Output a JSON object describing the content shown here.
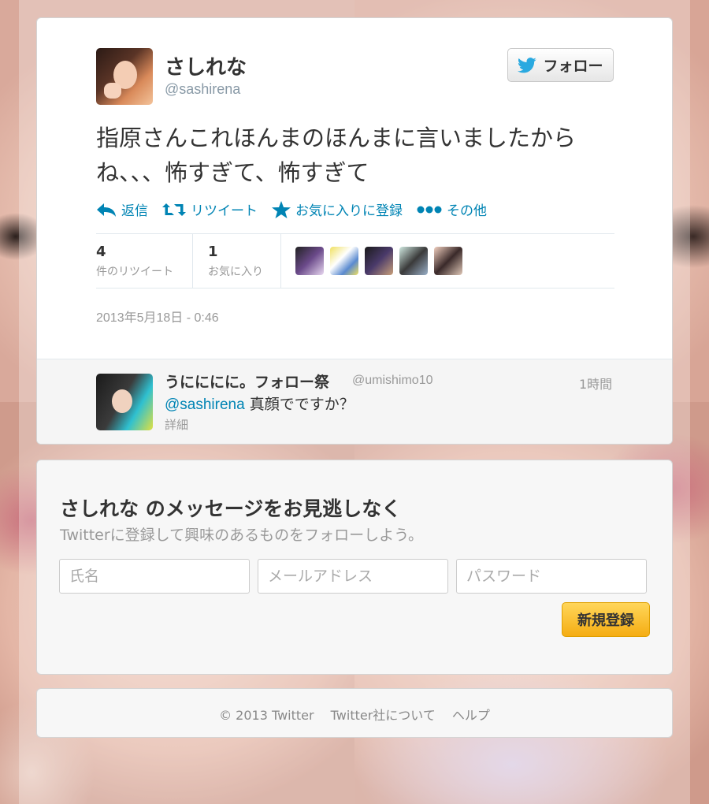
{
  "tweet": {
    "author_name": "さしれな",
    "author_handle": "@sashirena",
    "follow_label": "フォロー",
    "text_line1": "指原さんこれほんまのほんまに言いましたから",
    "text_line2": "ね、、、怖すぎて、怖すぎて",
    "actions": {
      "reply": "返信",
      "retweet": "リツイート",
      "favorite": "お気に入りに登録",
      "more": "その他"
    },
    "stats": {
      "retweets_count": "4",
      "retweets_label": "件のリツイート",
      "favorites_count": "1",
      "favorites_label": "お気に入り"
    },
    "timestamp": "2013年5月18日 - 0:46"
  },
  "reply": {
    "name": "うにににに。フォロー祭",
    "handle": "@umishimo10",
    "time": "1時間",
    "mention": "@sashirena",
    "text": "真顔でですか？",
    "details": "詳細"
  },
  "signup": {
    "title": "さしれな のメッセージをお見逃しなく",
    "subtitle": "Twitterに登録して興味のあるものをフォローしよう。",
    "name_placeholder": "氏名",
    "email_placeholder": "メールアドレス",
    "password_placeholder": "パスワード",
    "button_label": "新規登録"
  },
  "footer": {
    "copyright": "© 2013 Twitter",
    "about": "Twitter社について",
    "help": "ヘルプ"
  },
  "colors": {
    "link": "#0084b4",
    "muted": "#999999",
    "signup_button": "#f5ad13"
  }
}
